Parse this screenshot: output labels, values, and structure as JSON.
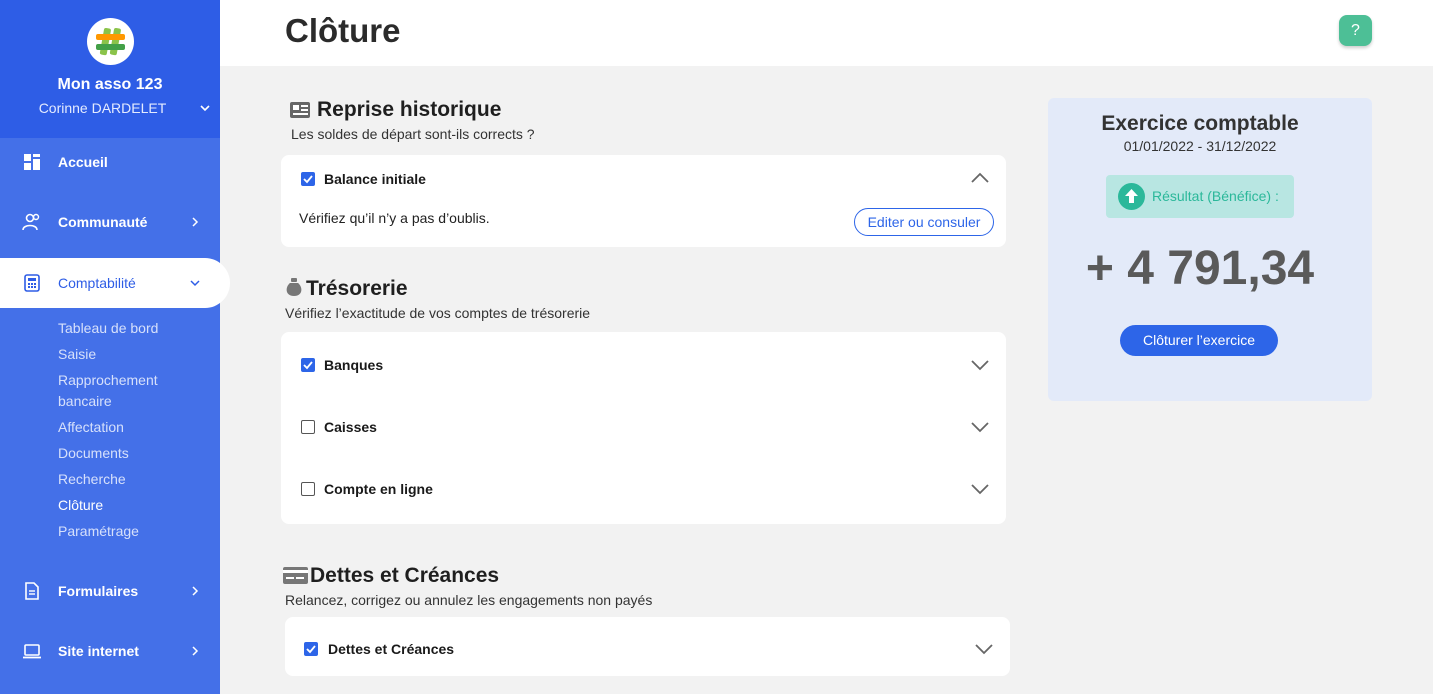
{
  "sidebar": {
    "org_name": "Mon asso 123",
    "user_name": "Corinne DARDELET",
    "nav": {
      "accueil": "Accueil",
      "communaute": "Communauté",
      "comptabilite": "Comptabilité",
      "formulaires": "Formulaires",
      "site": "Site internet"
    },
    "sub": [
      "Tableau de bord",
      "Saisie",
      "Rapprochement",
      "bancaire",
      "Affectation",
      "Documents",
      "Recherche",
      "Clôture",
      "Paramétrage"
    ]
  },
  "header": {
    "title": "Clôture",
    "help": "?"
  },
  "reprise": {
    "title": "Reprise historique",
    "subtitle": "Les soldes de départ sont-ils corrects ?",
    "row_label": "Balance initiale",
    "hint": "Vérifiez qu’il n’y a pas d’oublis.",
    "button": "Editer ou consuler"
  },
  "tresorerie": {
    "title": "Trésorerie",
    "subtitle": "Vérifiez l’exactitude de vos comptes de trésorerie",
    "rows": [
      {
        "label": "Banques",
        "checked": true
      },
      {
        "label": "Caisses",
        "checked": false
      },
      {
        "label": "Compte en ligne",
        "checked": false
      }
    ]
  },
  "dettes": {
    "title": "Dettes et Créances",
    "subtitle": "Relancez, corrigez ou annulez les engagements non payés",
    "row_label": "Dettes et Créances"
  },
  "exercice": {
    "title": "Exercice comptable",
    "dates": "01/01/2022 - 31/12/2022",
    "result_label": "Résultat (Bénéfice) :",
    "result_value": "+ 4 791,34",
    "close_button": "Clôturer l’exercice"
  },
  "colors": {
    "primary": "#2d65e8",
    "sidebar": "#4470e8",
    "success": "#2bb89a"
  }
}
